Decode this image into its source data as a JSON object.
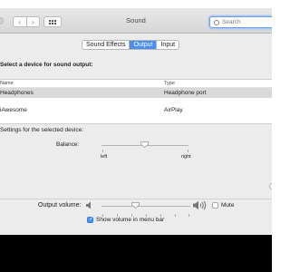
{
  "window": {
    "title": "Sound"
  },
  "search": {
    "placeholder": "Search"
  },
  "tabs": [
    {
      "label": "Sound Effects",
      "active": false
    },
    {
      "label": "Output",
      "active": true
    },
    {
      "label": "Input",
      "active": false
    }
  ],
  "output": {
    "heading": "Select a device for sound output:",
    "columns": {
      "name": "Name",
      "type": "Type"
    },
    "devices": [
      {
        "name": "Headphones",
        "type": "Headphone port",
        "selected": true
      },
      {
        "name": "iAwesome",
        "type": "AirPlay",
        "selected": false
      }
    ]
  },
  "settings": {
    "heading": "Settings for the selected device:",
    "balance_label": "Balance:",
    "balance_left": "left",
    "balance_right": "right",
    "balance_value": 0.5
  },
  "volume": {
    "label": "Output volume:",
    "level": 0.4,
    "mute_label": "Mute",
    "mute_checked": false,
    "show_in_menu_bar_label": "Show volume in menu bar",
    "show_in_menu_bar_checked": true
  },
  "colors": {
    "accent": "#4a8ef0",
    "selected_row": "#d9d9d9"
  },
  "icons": [
    "back-icon",
    "forward-icon",
    "grid-icon",
    "search-icon",
    "speaker-low-icon",
    "speaker-high-icon"
  ]
}
